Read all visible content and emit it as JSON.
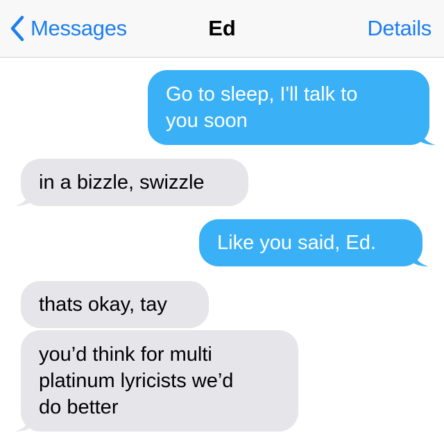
{
  "navbar": {
    "back_label": "Messages",
    "title": "Ed",
    "details_label": "Details"
  },
  "messages": [
    {
      "direction": "outgoing",
      "text": "Go to sleep, I'll talk to\nyou soon"
    },
    {
      "direction": "incoming",
      "text": "in a bizzle, swizzle"
    },
    {
      "direction": "outgoing",
      "text": "Like you said, Ed."
    },
    {
      "direction": "incoming",
      "text": "thats okay, tay"
    },
    {
      "direction": "incoming",
      "text": "you’d think for multi\nplatinum lyricists we’d\ndo better"
    }
  ],
  "colors": {
    "accent": "#1a7ef0",
    "outgoing_bubble": "#3ab1f6",
    "incoming_bubble": "#e5e5ea",
    "navbar_bg": "#f8f8f8"
  },
  "icons": {
    "back": "chevron-left-icon"
  }
}
